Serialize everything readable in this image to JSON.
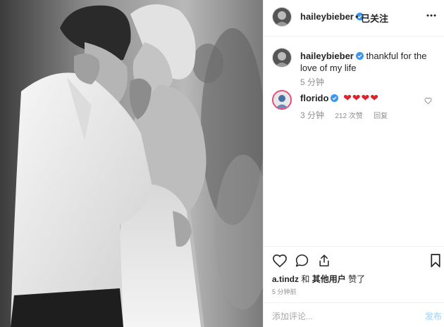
{
  "post": {
    "username": "haileybieber",
    "separator": "•",
    "follow_status": "已关注"
  },
  "caption": {
    "username": "haileybieber",
    "text": "thankful for the love of my life",
    "time": "5 分钟"
  },
  "comment": {
    "username": "florido",
    "hearts": "❤❤❤❤",
    "time": "3 分钟",
    "likes": "212 次赞",
    "reply": "回复"
  },
  "likes": {
    "user": "a.tindz",
    "joiner": "和",
    "others": "其他用户",
    "suffix": "赞了"
  },
  "post_time": "5 分钟前",
  "add_comment": {
    "placeholder": "添加评论...",
    "post_label": "发布"
  },
  "colors": {
    "verified_blue": "#3897f0",
    "heart_red": "#e0202b",
    "post_button_disabled": "#b2dffc",
    "story_ring": "#e24b7a"
  }
}
